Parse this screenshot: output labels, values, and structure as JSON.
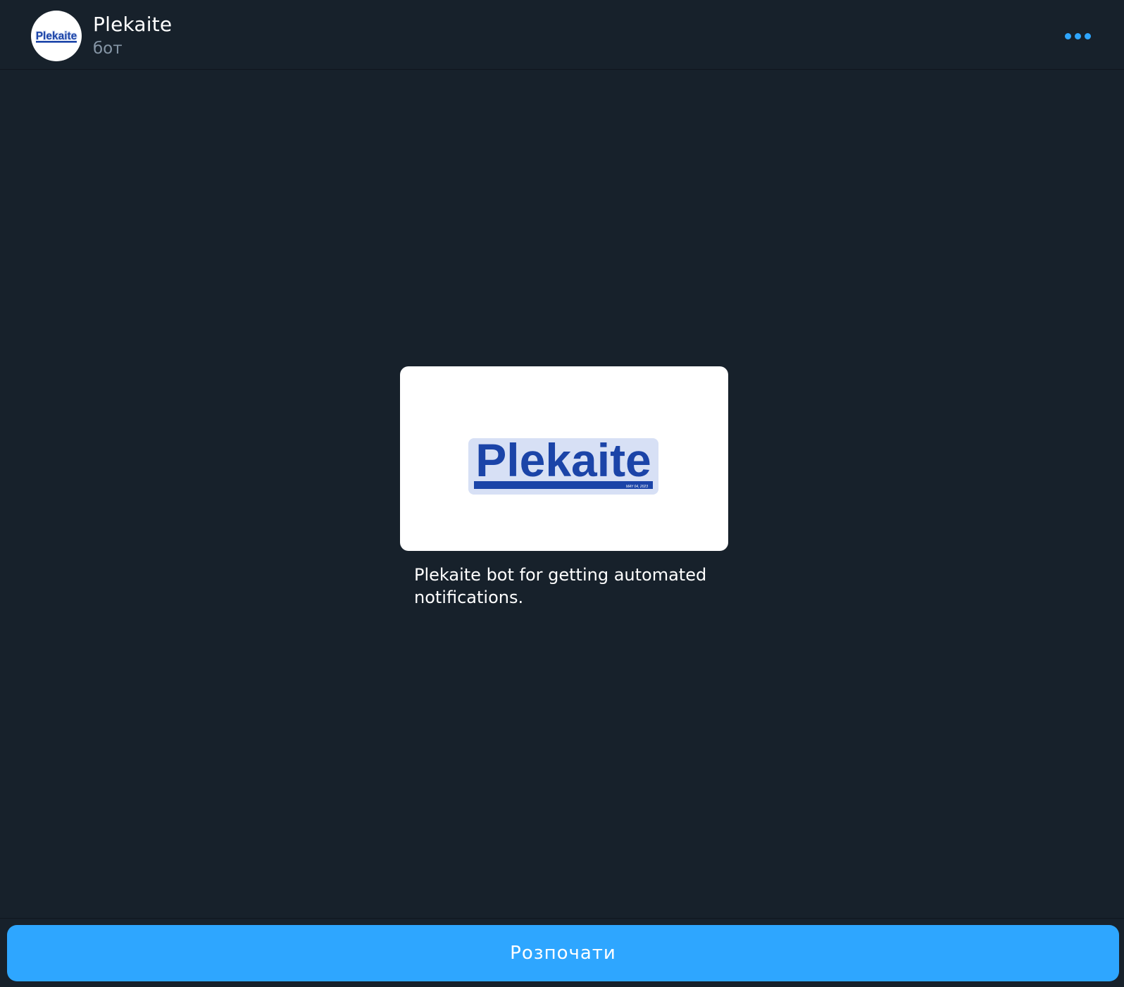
{
  "header": {
    "title": "Plekaite",
    "subtitle": "бот",
    "avatar_logo_text": "Plekaite",
    "more_icon": "more-horizontal-icon"
  },
  "bot_info": {
    "image_logo_text": "Plekaite",
    "image_date_text": "MAY 04, 2023",
    "description": "Plekaite bot for getting automated notifications."
  },
  "footer": {
    "start_label": "Розпочати"
  },
  "colors": {
    "background": "#17212b",
    "accent": "#2ea6ff",
    "logo_blue": "#1b44a8",
    "logo_outline": "#d7e0f5",
    "subtitle": "#8696a6"
  }
}
